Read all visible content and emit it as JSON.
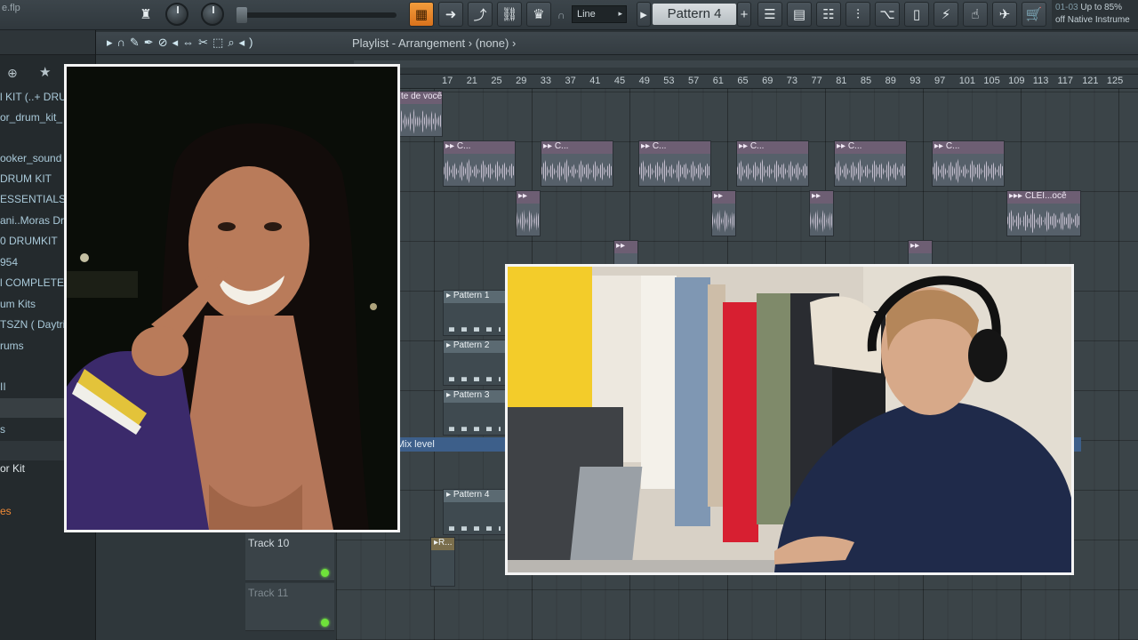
{
  "toolbar": {
    "file_name": "e.flp",
    "snap_mode": "Line",
    "pattern": "Pattern 4",
    "news_date": "01-03",
    "news_text_1": "Up to 85%",
    "news_text_2": "off Native Instrume"
  },
  "playlist": {
    "title": "Playlist - Arrangement",
    "separator": "›",
    "selection": "(none)",
    "ruler": [
      "17",
      "21",
      "25",
      "29",
      "33",
      "37",
      "41",
      "45",
      "49",
      "53",
      "57",
      "61",
      "65",
      "69",
      "73",
      "77",
      "81",
      "85",
      "89",
      "93",
      "97",
      "101",
      "105",
      "109",
      "113",
      "117",
      "121",
      "125"
    ],
    "tracks": [
      "Track 10",
      "Track 11"
    ],
    "clips": {
      "audio_a": "te de você",
      "audio_b": "C...",
      "audio_c": "CLEI...ocê",
      "pattern_1": "Pattern 1",
      "pattern_2": "Pattern 2",
      "pattern_3": "Pattern 3",
      "pattern_4": "Pattern 4",
      "pattern_r": "R..."
    },
    "automation": "Mix level"
  },
  "browser": {
    "items": [
      "l KIT (..+ DRUM",
      "or_drum_kit_",
      "ooker_sound",
      "DRUM KIT",
      "ESSENTIALS",
      "ani..Moras Dr",
      "0 DRUMKIT",
      "954",
      "l COMPLETE",
      "um Kits",
      "TSZN ( Daytri",
      "rums",
      "II",
      "s",
      "or Kit",
      "es"
    ]
  },
  "colors": {
    "accent_orange": "#e8842a",
    "grid": "#3b4448",
    "clip_header": "#6d5e73",
    "led_green": "#6fe23a"
  }
}
